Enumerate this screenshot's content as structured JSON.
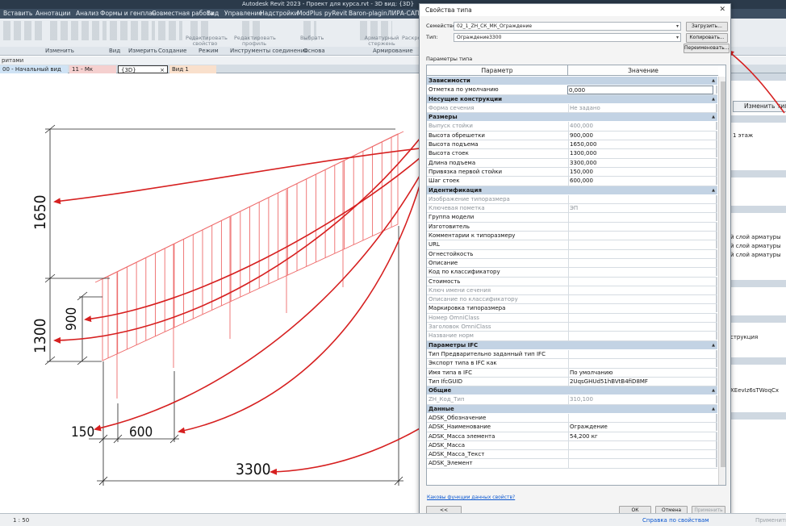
{
  "app": {
    "title": "Autodesk Revit 2023 - Проект для курса.rvt - 3D вид: {3D}",
    "menu": [
      "Вставить",
      "Аннотации",
      "Анализ",
      "Формы и генплан",
      "Совместная работа",
      "Вид",
      "Управление",
      "Надстройки",
      "ModPlus",
      "pyRevit",
      "Baron-plagin",
      "ЛИРА-САПР"
    ],
    "ribbon_tools": [
      "Редактировать свойство",
      "Редактировать профиль",
      "Выбрать",
      "Арматурный стержень",
      "Раскро"
    ],
    "ribbon_groups": [
      "Изменить",
      "Вид",
      "Измерить",
      "Создание",
      "Режим",
      "Инструменты соединения",
      "Основа",
      "Армирование"
    ],
    "strip_text": "ритами",
    "view_tabs": [
      {
        "label": "00 - Начальный вид",
        "color": "#cfe3f5"
      },
      {
        "label": "11 - Мк",
        "color": "#f5d0cf"
      },
      {
        "label": "{3D}",
        "color": "#ffffff",
        "close": "×"
      },
      {
        "label": "Вид 1",
        "color": "#f9e0cc"
      }
    ],
    "status": {
      "scale": "1 : 50",
      "help": "Справка по свойствам",
      "apply": "Применить"
    }
  },
  "right_panel": {
    "edit_type_button": "Изменить тип",
    "rows": [
      "1 этаж",
      "й слой арматуры",
      "й слой арматуры",
      "й слой арматуры",
      "струкция",
      "XEevIz6sTWoqCx"
    ]
  },
  "drawing": {
    "dimensions": [
      "1650",
      "900",
      "1300",
      "150",
      "600",
      "3300"
    ]
  },
  "dialog": {
    "title": "Свойства типа",
    "close": "✕",
    "family_label": "Семейство:",
    "family_value": "02_1_ZH_СК_МК_Ограждение",
    "type_label": "Тип:",
    "type_value": "Ограждение3300",
    "buttons": {
      "load": "Загрузить...",
      "duplicate": "Копировать...",
      "rename": "Переименовать..."
    },
    "params_label": "Параметры типа",
    "col_param": "Параметр",
    "col_value": "Значение",
    "groups": [
      {
        "name": "Зависимости",
        "rows": [
          {
            "name": "Отметка по умолчанию",
            "value": "0,000",
            "edit": true
          }
        ]
      },
      {
        "name": "Несущие конструкции",
        "rows": [
          {
            "name": "Форма сечения",
            "value": "Не задано",
            "gray": true
          }
        ]
      },
      {
        "name": "Размеры",
        "rows": [
          {
            "name": "Выпуск стойки",
            "value": "400,000",
            "gray": true
          },
          {
            "name": "Высота обрешетки",
            "value": "900,000"
          },
          {
            "name": "Высота подъема",
            "value": "1650,000"
          },
          {
            "name": "Высота стоек",
            "value": "1300,000"
          },
          {
            "name": "Длина подъема",
            "value": "3300,000"
          },
          {
            "name": "Привязка первой стойки",
            "value": "150,000"
          },
          {
            "name": "Шаг стоек",
            "value": "600,000"
          }
        ]
      },
      {
        "name": "Идентификация",
        "rows": [
          {
            "name": "Изображение типоразмера",
            "value": "",
            "gray": true
          },
          {
            "name": "Ключевая пометка",
            "value": "ЭП",
            "gray": true
          },
          {
            "name": "Группа модели",
            "value": ""
          },
          {
            "name": "Изготовитель",
            "value": ""
          },
          {
            "name": "Комментарии к типоразмеру",
            "value": ""
          },
          {
            "name": "URL",
            "value": ""
          },
          {
            "name": "Огнестойкость",
            "value": ""
          },
          {
            "name": "Описание",
            "value": ""
          },
          {
            "name": "Код по классификатору",
            "value": ""
          },
          {
            "name": "Стоимость",
            "value": ""
          },
          {
            "name": "Ключ имени сечения",
            "value": "",
            "gray": true
          },
          {
            "name": "Описание по классификатору",
            "value": "",
            "gray": true
          },
          {
            "name": "Маркировка типоразмера",
            "value": ""
          },
          {
            "name": "Номер OmniClass",
            "value": "",
            "gray": true
          },
          {
            "name": "Заголовок OmniClass",
            "value": "",
            "gray": true
          },
          {
            "name": "Название норм",
            "value": "",
            "gray": true
          }
        ]
      },
      {
        "name": "Параметры IFC",
        "rows": [
          {
            "name": "Тип Предварительно заданный тип IFC",
            "value": ""
          },
          {
            "name": "Экспорт типа в IFC как",
            "value": ""
          },
          {
            "name": "Имя типа в IFC",
            "value": "По умолчанию"
          },
          {
            "name": "Тип IfcGUID",
            "value": "2UqsGHUd51hBVtB4fiD8MF"
          }
        ]
      },
      {
        "name": "Общие",
        "rows": [
          {
            "name": "ZH_Код_Тип",
            "value": "310,100",
            "gray": true
          }
        ]
      },
      {
        "name": "Данные",
        "rows": [
          {
            "name": "ADSK_Обозначение",
            "value": ""
          },
          {
            "name": "ADSK_Наименование",
            "value": "Ограждение"
          },
          {
            "name": "ADSK_Масса элемента",
            "value": "54,200 кг"
          },
          {
            "name": "ADSK_Масса",
            "value": ""
          },
          {
            "name": "ADSK_Масса_Текст",
            "value": ""
          },
          {
            "name": "ADSK_Элемент",
            "value": ""
          }
        ]
      }
    ],
    "help_link": "Каковы функции данных свойств?",
    "footer": {
      "preview": "<< Просмотр",
      "ok": "ОК",
      "cancel": "Отмена",
      "apply": "Применить"
    }
  }
}
